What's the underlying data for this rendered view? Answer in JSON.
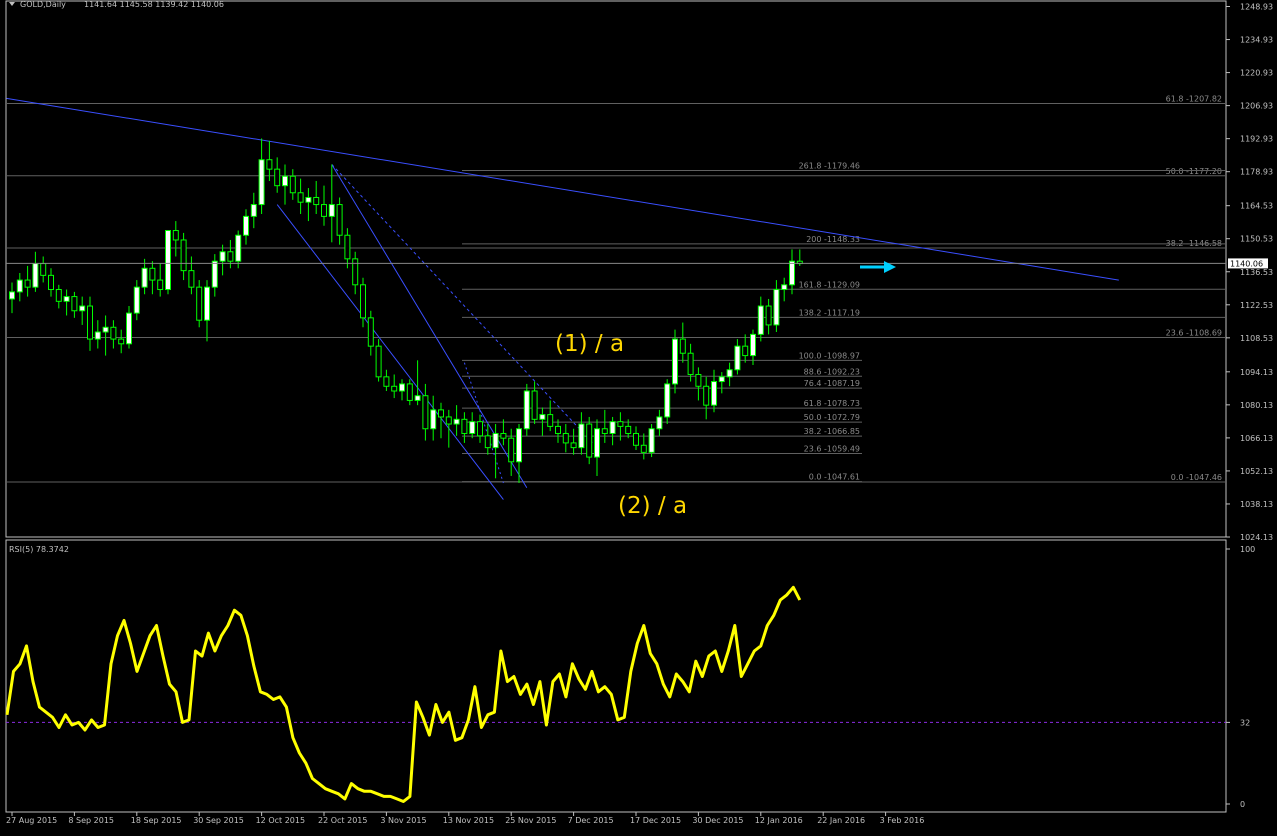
{
  "chart_data": {
    "type": "candlestick",
    "title": "GOLD,Daily",
    "ohlc_header": [
      "1141.64",
      "1145.58",
      "1139.42",
      "1140.06"
    ],
    "colors": {
      "background": "#000000",
      "grid": "#5a5a5a",
      "axis": "#c0c0c0",
      "text": "#c0c0c0",
      "candle_up": "#ffffff",
      "candle_down": "#000000",
      "candle_wick": "#00ff00",
      "trendline": "#3a4fff",
      "fib_line": "#606060",
      "fib_text": "#8a8a8a",
      "wave_label": "#ffd700",
      "arrow": "#00d0ff",
      "rsi_line": "#ffff00",
      "rsi_level": "#8a2be2",
      "price_label_bg": "#ffffff",
      "price_label_fg": "#000000"
    },
    "price_axis": {
      "ticks": [
        "1248.93",
        "1234.93",
        "1220.93",
        "1206.93",
        "1192.93",
        "1178.93",
        "1164.53",
        "1150.53",
        "1136.53",
        "1122.53",
        "1108.53",
        "1094.13",
        "1080.13",
        "1066.13",
        "1052.13",
        "1038.13",
        "1024.13"
      ],
      "current": "1140.06"
    },
    "date_labels": [
      "27 Aug 2015",
      "8 Sep 2015",
      "18 Sep 2015",
      "30 Sep 2015",
      "12 Oct 2015",
      "22 Oct 2015",
      "3 Nov 2015",
      "13 Nov 2015",
      "25 Nov 2015",
      "7 Dec 2015",
      "17 Dec 2015",
      "30 Dec 2015",
      "12 Jan 2016",
      "22 Jan 2016",
      "3 Feb 2016"
    ],
    "date_label_index": [
      0,
      8,
      16,
      24,
      32,
      40,
      48,
      56,
      64,
      72,
      80,
      88,
      96,
      104,
      112
    ],
    "candles": [
      [
        1125,
        1132,
        1119,
        1128
      ],
      [
        1128,
        1136,
        1124,
        1133
      ],
      [
        1133,
        1139,
        1126,
        1130
      ],
      [
        1130,
        1145,
        1128,
        1140
      ],
      [
        1140,
        1143,
        1132,
        1135
      ],
      [
        1135,
        1138,
        1126,
        1129
      ],
      [
        1129,
        1131,
        1121,
        1124
      ],
      [
        1124,
        1129,
        1118,
        1126
      ],
      [
        1126,
        1128,
        1117,
        1120
      ],
      [
        1120,
        1126,
        1114,
        1122
      ],
      [
        1122,
        1126,
        1103,
        1108
      ],
      [
        1108,
        1116,
        1104,
        1111
      ],
      [
        1111,
        1118,
        1101,
        1113
      ],
      [
        1113,
        1116,
        1104,
        1108
      ],
      [
        1108,
        1112,
        1102,
        1106
      ],
      [
        1106,
        1122,
        1104,
        1119
      ],
      [
        1119,
        1133,
        1116,
        1130
      ],
      [
        1130,
        1142,
        1127,
        1138
      ],
      [
        1138,
        1141,
        1127,
        1133
      ],
      [
        1133,
        1140,
        1126,
        1129
      ],
      [
        1129,
        1148,
        1127,
        1154
      ],
      [
        1154,
        1158,
        1143,
        1150
      ],
      [
        1150,
        1153,
        1133,
        1137
      ],
      [
        1137,
        1143,
        1127,
        1130
      ],
      [
        1130,
        1133,
        1113,
        1116
      ],
      [
        1116,
        1133,
        1107,
        1130
      ],
      [
        1130,
        1144,
        1126,
        1141
      ],
      [
        1141,
        1148,
        1135,
        1145
      ],
      [
        1145,
        1150,
        1138,
        1141
      ],
      [
        1141,
        1154,
        1138,
        1152
      ],
      [
        1152,
        1163,
        1148,
        1160
      ],
      [
        1160,
        1170,
        1155,
        1165
      ],
      [
        1165,
        1193,
        1161,
        1184
      ],
      [
        1184,
        1192,
        1175,
        1180
      ],
      [
        1180,
        1185,
        1170,
        1173
      ],
      [
        1173,
        1182,
        1165,
        1177
      ],
      [
        1177,
        1180,
        1167,
        1170
      ],
      [
        1170,
        1176,
        1161,
        1166
      ],
      [
        1166,
        1172,
        1158,
        1168
      ],
      [
        1168,
        1175,
        1161,
        1165
      ],
      [
        1165,
        1173,
        1156,
        1160
      ],
      [
        1160,
        1182,
        1149,
        1165
      ],
      [
        1165,
        1168,
        1148,
        1152
      ],
      [
        1152,
        1155,
        1138,
        1142
      ],
      [
        1142,
        1145,
        1127,
        1131
      ],
      [
        1131,
        1134,
        1113,
        1117
      ],
      [
        1117,
        1120,
        1101,
        1105
      ],
      [
        1105,
        1108,
        1090,
        1092
      ],
      [
        1092,
        1095,
        1086,
        1088
      ],
      [
        1088,
        1093,
        1083,
        1086
      ],
      [
        1086,
        1091,
        1082,
        1089
      ],
      [
        1089,
        1091,
        1080,
        1082
      ],
      [
        1082,
        1099,
        1080,
        1084
      ],
      [
        1084,
        1089,
        1065,
        1070
      ],
      [
        1070,
        1084,
        1065,
        1078
      ],
      [
        1078,
        1081,
        1066,
        1075
      ],
      [
        1075,
        1078,
        1062,
        1072
      ],
      [
        1072,
        1080,
        1067,
        1074
      ],
      [
        1074,
        1077,
        1064,
        1068
      ],
      [
        1068,
        1077,
        1066,
        1073
      ],
      [
        1073,
        1076,
        1064,
        1067
      ],
      [
        1067,
        1072,
        1059,
        1062
      ],
      [
        1062,
        1072,
        1049,
        1068
      ],
      [
        1068,
        1074,
        1063,
        1066
      ],
      [
        1066,
        1070,
        1050,
        1056
      ],
      [
        1056,
        1072,
        1047,
        1070
      ],
      [
        1070,
        1089,
        1067,
        1086
      ],
      [
        1086,
        1090,
        1072,
        1074
      ],
      [
        1074,
        1079,
        1067,
        1076
      ],
      [
        1076,
        1082,
        1069,
        1071
      ],
      [
        1071,
        1074,
        1064,
        1068
      ],
      [
        1068,
        1072,
        1060,
        1064
      ],
      [
        1064,
        1070,
        1059,
        1062
      ],
      [
        1062,
        1077,
        1059,
        1072
      ],
      [
        1072,
        1075,
        1055,
        1058
      ],
      [
        1058,
        1074,
        1050,
        1070
      ],
      [
        1070,
        1078,
        1064,
        1068
      ],
      [
        1068,
        1075,
        1063,
        1073
      ],
      [
        1073,
        1077,
        1065,
        1071
      ],
      [
        1071,
        1074,
        1066,
        1068
      ],
      [
        1068,
        1071,
        1061,
        1063
      ],
      [
        1063,
        1068,
        1057,
        1060
      ],
      [
        1060,
        1072,
        1058,
        1070
      ],
      [
        1070,
        1078,
        1067,
        1075
      ],
      [
        1075,
        1091,
        1072,
        1089
      ],
      [
        1089,
        1112,
        1085,
        1108
      ],
      [
        1108,
        1115,
        1098,
        1102
      ],
      [
        1102,
        1106,
        1090,
        1093
      ],
      [
        1093,
        1096,
        1082,
        1088
      ],
      [
        1088,
        1092,
        1074,
        1080
      ],
      [
        1080,
        1095,
        1077,
        1090
      ],
      [
        1090,
        1094,
        1085,
        1092
      ],
      [
        1092,
        1098,
        1088,
        1095
      ],
      [
        1095,
        1108,
        1093,
        1105
      ],
      [
        1105,
        1110,
        1098,
        1101
      ],
      [
        1101,
        1112,
        1097,
        1110
      ],
      [
        1110,
        1126,
        1107,
        1122
      ],
      [
        1122,
        1125,
        1110,
        1114
      ],
      [
        1114,
        1133,
        1111,
        1129
      ],
      [
        1129,
        1134,
        1124,
        1131
      ],
      [
        1131,
        1146,
        1127,
        1141
      ],
      [
        1141,
        1146,
        1139,
        1140
      ]
    ],
    "rsi": {
      "label": "RSI(5) 78.3742",
      "axis_ticks": [
        "100",
        "32",
        "0"
      ],
      "level": 32,
      "values": [
        35,
        52,
        55,
        62,
        48,
        38,
        36,
        34,
        30,
        35,
        31,
        32,
        29,
        33,
        30,
        31,
        55,
        66,
        72,
        63,
        52,
        59,
        66,
        70,
        58,
        47,
        44,
        32,
        33,
        60,
        58,
        67,
        60,
        66,
        70,
        76,
        74,
        66,
        54,
        44,
        43,
        41,
        42,
        38,
        26,
        20,
        16,
        10,
        8,
        6,
        5,
        4,
        2,
        8,
        6,
        5,
        5,
        4,
        3,
        3,
        2,
        1,
        3,
        40,
        34,
        27,
        39,
        32,
        36,
        25,
        26,
        33,
        46,
        30,
        35,
        36,
        60,
        48,
        50,
        43,
        47,
        39,
        48,
        31,
        48,
        51,
        42,
        55,
        49,
        45,
        52,
        44,
        46,
        43,
        33,
        34,
        52,
        63,
        70,
        59,
        55,
        47,
        42,
        51,
        48,
        44,
        56,
        50,
        58,
        60,
        52,
        60,
        70,
        50,
        55,
        60,
        62,
        70,
        74,
        80,
        82,
        85,
        80
      ]
    }
  },
  "wave_labels": [
    "(1) / a",
    "(2) / a"
  ],
  "fib_sets": [
    {
      "levels": [
        [
          "61.8",
          "1207.82"
        ],
        [
          "50.0",
          "1177.20"
        ],
        [
          "38.2",
          "1146.58"
        ],
        [
          "23.6",
          "1108.69"
        ],
        [
          "0.0",
          "1047.46"
        ]
      ]
    },
    {
      "levels": [
        [
          "261.8",
          "1179.46"
        ],
        [
          "200",
          "1148.33"
        ],
        [
          "161.8",
          "1129.09"
        ],
        [
          "138.2",
          "1117.19"
        ]
      ]
    },
    {
      "levels": [
        [
          "100.0",
          "1098.97"
        ],
        [
          "88.6",
          "1092.23"
        ],
        [
          "76.4",
          "1087.19"
        ],
        [
          "61.8",
          "1078.73"
        ],
        [
          "50.0",
          "1072.79"
        ],
        [
          "38.2",
          "1066.85"
        ],
        [
          "23.6",
          "1059.49"
        ],
        [
          "0.0",
          "1047.61"
        ]
      ]
    }
  ]
}
